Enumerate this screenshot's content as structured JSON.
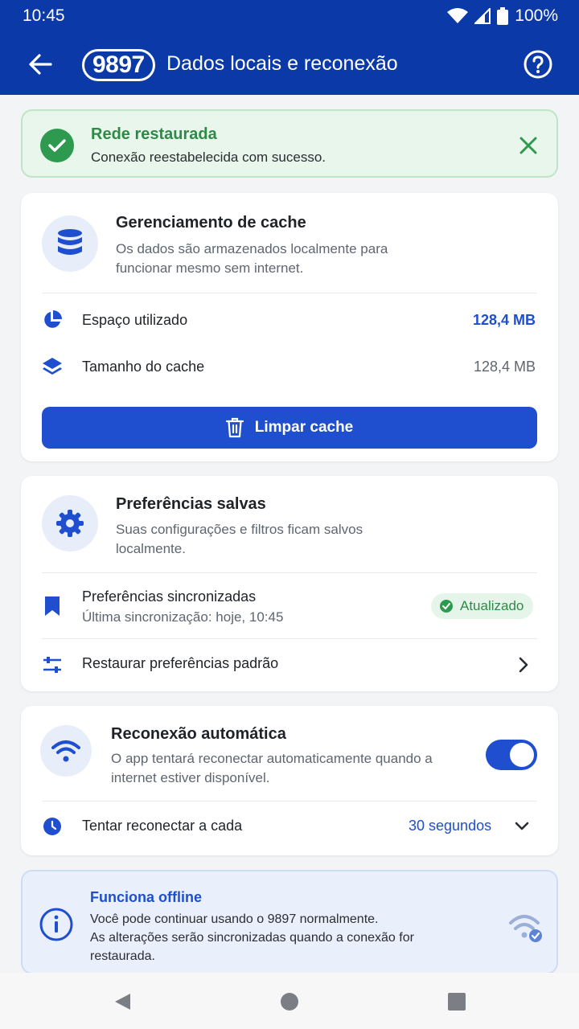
{
  "status_bar": {
    "time": "10:45",
    "battery": "100%"
  },
  "app_bar": {
    "logo": "9897",
    "title": "Dados locais e reconexão"
  },
  "banner": {
    "title": "Rede restaurada",
    "text": "Conexão reestabelecida com sucesso."
  },
  "cache_card": {
    "title": "Gerenciamento de cache",
    "description": "Os dados são armazenados localmente para funcionar mesmo sem internet.",
    "rows": [
      {
        "label": "Espaço utilizado",
        "value": "128,4 MB"
      },
      {
        "label": "Tamanho do cache",
        "value": "128,4 MB"
      }
    ],
    "clear_button": "Limpar cache"
  },
  "prefs_card": {
    "title": "Preferências salvas",
    "description": "Suas configurações e filtros ficam salvos localmente.",
    "synced_label": "Preferências sincronizadas",
    "synced_sub": "Última sincronização: hoje, 10:45",
    "badge": "Atualizado",
    "restore_label": "Restaurar preferências padrão"
  },
  "reconnect_card": {
    "title": "Reconexão automática",
    "description": "O app tentará reconectar automaticamente quando a internet estiver disponível.",
    "toggle_on": true,
    "retry_label": "Tentar reconectar a cada",
    "retry_value": "30 segundos"
  },
  "offline_info": {
    "title": "Funciona offline",
    "line1": "Você pode continuar usando o 9897 normalmente.",
    "line2": "As alterações serão sincronizadas quando a conexão for restaurada."
  },
  "colors": {
    "primary": "#0b3aa8",
    "accent": "#1f4fcf",
    "success": "#2e9a4f"
  }
}
